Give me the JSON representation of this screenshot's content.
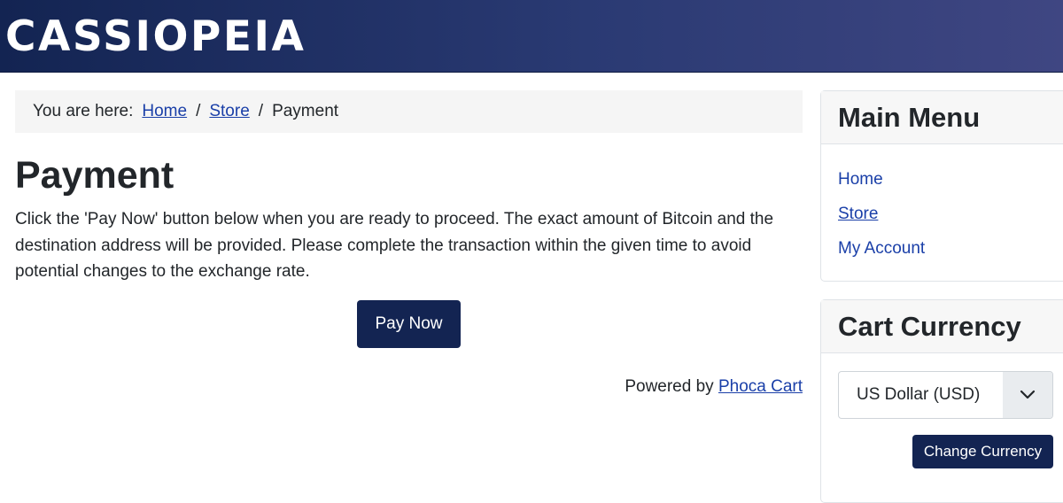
{
  "site": {
    "brand": "CASSIOPEIA"
  },
  "breadcrumb": {
    "prefix": "You are here:",
    "items": [
      "Home",
      "Store",
      "Payment"
    ],
    "separator": "/"
  },
  "main": {
    "title": "Payment",
    "intro": "Click the 'Pay Now' button below when you are ready to proceed. The exact amount of Bitcoin and the destination address will be provided. Please complete the transaction within the given time to avoid potential changes to the exchange rate.",
    "pay_button": "Pay Now",
    "powered_prefix": "Powered by",
    "powered_link": "Phoca Cart"
  },
  "sidebar": {
    "main_menu": {
      "title": "Main Menu",
      "items": [
        "Home",
        "Store",
        "My Account"
      ]
    },
    "cart_currency": {
      "title": "Cart Currency",
      "selected": "US Dollar (USD)",
      "button": "Change Currency"
    }
  },
  "colors": {
    "brand_dark": "#132452",
    "link": "#1a3fa8"
  },
  "icons": {
    "select_arrow": "chevron-down-icon"
  }
}
